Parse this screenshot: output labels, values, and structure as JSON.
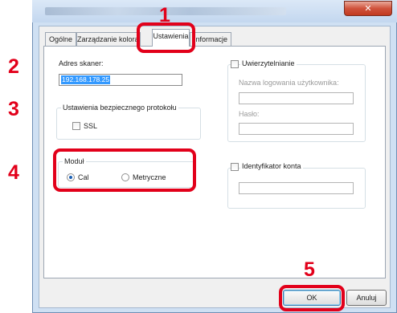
{
  "window": {
    "close_icon": "close-icon"
  },
  "tabs": [
    {
      "label": "Ogólne"
    },
    {
      "label": "Zarządzanie kolorami"
    },
    {
      "label": "Ustawienia"
    },
    {
      "label": "Informacje"
    }
  ],
  "scanner": {
    "label": "Adres skaner:",
    "value": "192.168.178.25"
  },
  "protocol": {
    "legend": "Ustawienia bezpiecznego protokołu",
    "ssl_label": "SSL",
    "ssl_checked": false
  },
  "module": {
    "legend": "Moduł",
    "options": [
      {
        "label": "Cal",
        "selected": true
      },
      {
        "label": "Metryczne",
        "selected": false
      }
    ]
  },
  "auth": {
    "checkbox_label": "Uwierzytelnianie",
    "checked": false,
    "username_label": "Nazwa logowania użytkownika:",
    "username_value": "",
    "password_label": "Hasło:",
    "password_value": ""
  },
  "account": {
    "checkbox_label": "Identyfikator konta",
    "checked": false,
    "value": ""
  },
  "buttons": {
    "ok": "OK",
    "cancel": "Anuluj"
  },
  "callouts": [
    "1",
    "2",
    "3",
    "4",
    "5"
  ],
  "colors": {
    "callout": "#e2001a",
    "selection": "#3399ff"
  }
}
